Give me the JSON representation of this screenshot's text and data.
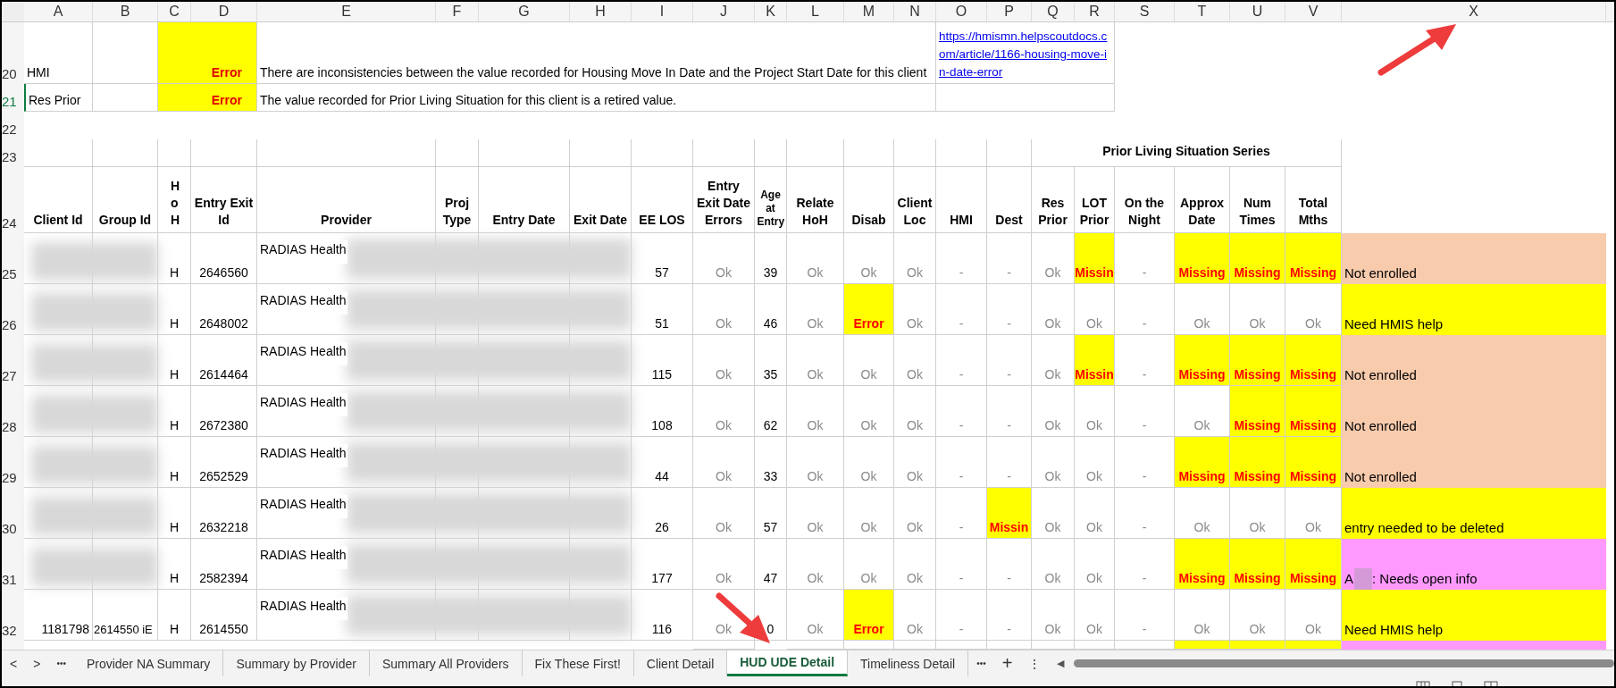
{
  "column_headers": [
    "A",
    "B",
    "C",
    "D",
    "E",
    "F",
    "G",
    "H",
    "I",
    "J",
    "K",
    "L",
    "M",
    "N",
    "O",
    "P",
    "Q",
    "R",
    "S",
    "T",
    "U",
    "V",
    "X"
  ],
  "notes": [
    {
      "row": "20",
      "active": false,
      "code": "HMI",
      "status": "Error",
      "text": "There are inconsistencies between the value recorded for Housing Move In Date and the Project Start Date for this client",
      "link": "https://hmismn.helpscoutdocs.com/article/1166-housing-move-in-date-error"
    },
    {
      "row": "21",
      "active": true,
      "code": "Res Prior",
      "status": "Error",
      "text": "The value recorded for Prior Living Situation for this client is a retired value."
    }
  ],
  "blank_row": "22",
  "group_row": {
    "row": "23",
    "title": "Prior Living Situation Series"
  },
  "header_row": {
    "row": "24",
    "headers": [
      "Client Id",
      "Group Id",
      "HoH",
      "Entry Exit Id",
      "Provider",
      "Proj Type",
      "Entry Date",
      "Exit Date",
      "EE LOS",
      "Entry Exit Date Errors",
      "Age at Entry",
      "Relate HoH",
      "Disab",
      "Client Loc",
      "HMI",
      "Dest",
      "Res Prior",
      "LOT Prior",
      "On the Night",
      "Approx Date",
      "Num Times",
      "Total Mths"
    ]
  },
  "rows": [
    {
      "row": "25",
      "redacted": true,
      "hoh": "H",
      "entry_exit_id": "2646560",
      "provider": "RADIAS Health",
      "ee_los": "57",
      "age": "39",
      "note": "Not enrolled",
      "color": "#f8cbad",
      "checks": [
        {
          "text": "Ok",
          "flagged": false
        },
        {
          "text": "Ok",
          "flagged": false
        },
        {
          "text": "Ok",
          "flagged": false
        },
        {
          "text": "Ok",
          "flagged": false
        },
        {
          "text": "-",
          "flagged": false
        },
        {
          "text": "-",
          "flagged": false
        },
        {
          "text": "Ok",
          "flagged": false
        },
        {
          "text": "Missin",
          "flagged": true
        },
        {
          "text": "-",
          "flagged": false
        },
        {
          "text": "Missing",
          "flagged": true
        },
        {
          "text": "Missing",
          "flagged": true
        },
        {
          "text": "Missing",
          "flagged": true
        }
      ]
    },
    {
      "row": "26",
      "redacted": true,
      "hoh": "H",
      "entry_exit_id": "2648002",
      "provider": "RADIAS Health",
      "ee_los": "51",
      "age": "46",
      "note": "Need HMIS help",
      "color": "#ffff00",
      "checks": [
        {
          "text": "Ok",
          "flagged": false
        },
        {
          "text": "Ok",
          "flagged": false
        },
        {
          "text": "Error",
          "flagged": true
        },
        {
          "text": "Ok",
          "flagged": false
        },
        {
          "text": "-",
          "flagged": false
        },
        {
          "text": "-",
          "flagged": false
        },
        {
          "text": "Ok",
          "flagged": false
        },
        {
          "text": "Ok",
          "flagged": false
        },
        {
          "text": "-",
          "flagged": false
        },
        {
          "text": "Ok",
          "flagged": false
        },
        {
          "text": "Ok",
          "flagged": false
        },
        {
          "text": "Ok",
          "flagged": false
        }
      ]
    },
    {
      "row": "27",
      "redacted": true,
      "hoh": "H",
      "entry_exit_id": "2614464",
      "provider": "RADIAS Health",
      "ee_los": "115",
      "age": "35",
      "note": "Not enrolled",
      "color": "#f8cbad",
      "checks": [
        {
          "text": "Ok",
          "flagged": false
        },
        {
          "text": "Ok",
          "flagged": false
        },
        {
          "text": "Ok",
          "flagged": false
        },
        {
          "text": "Ok",
          "flagged": false
        },
        {
          "text": "-",
          "flagged": false
        },
        {
          "text": "-",
          "flagged": false
        },
        {
          "text": "Ok",
          "flagged": false
        },
        {
          "text": "Missin",
          "flagged": true
        },
        {
          "text": "-",
          "flagged": false
        },
        {
          "text": "Missing",
          "flagged": true
        },
        {
          "text": "Missing",
          "flagged": true
        },
        {
          "text": "Missing",
          "flagged": true
        }
      ]
    },
    {
      "row": "28",
      "redacted": true,
      "hoh": "H",
      "entry_exit_id": "2672380",
      "provider": "RADIAS Health",
      "ee_los": "108",
      "age": "62",
      "note": "Not enrolled",
      "color": "#f8cbad",
      "checks": [
        {
          "text": "Ok",
          "flagged": false
        },
        {
          "text": "Ok",
          "flagged": false
        },
        {
          "text": "Ok",
          "flagged": false
        },
        {
          "text": "Ok",
          "flagged": false
        },
        {
          "text": "-",
          "flagged": false
        },
        {
          "text": "-",
          "flagged": false
        },
        {
          "text": "Ok",
          "flagged": false
        },
        {
          "text": "Ok",
          "flagged": false
        },
        {
          "text": "-",
          "flagged": false
        },
        {
          "text": "Ok",
          "flagged": false
        },
        {
          "text": "Missing",
          "flagged": true
        },
        {
          "text": "Missing",
          "flagged": true
        }
      ]
    },
    {
      "row": "29",
      "redacted": true,
      "hoh": "H",
      "entry_exit_id": "2652529",
      "provider": "RADIAS Health",
      "ee_los": "44",
      "age": "33",
      "note": "Not enrolled",
      "color": "#f8cbad",
      "checks": [
        {
          "text": "Ok",
          "flagged": false
        },
        {
          "text": "Ok",
          "flagged": false
        },
        {
          "text": "Ok",
          "flagged": false
        },
        {
          "text": "Ok",
          "flagged": false
        },
        {
          "text": "-",
          "flagged": false
        },
        {
          "text": "-",
          "flagged": false
        },
        {
          "text": "Ok",
          "flagged": false
        },
        {
          "text": "Ok",
          "flagged": false
        },
        {
          "text": "-",
          "flagged": false
        },
        {
          "text": "Missing",
          "flagged": true
        },
        {
          "text": "Missing",
          "flagged": true
        },
        {
          "text": "Missing",
          "flagged": true
        }
      ]
    },
    {
      "row": "30",
      "redacted": true,
      "hoh": "H",
      "entry_exit_id": "2632218",
      "provider": "RADIAS Health",
      "ee_los": "26",
      "age": "57",
      "note": "entry needed to be deleted",
      "color": "#ffff00",
      "checks": [
        {
          "text": "Ok",
          "flagged": false
        },
        {
          "text": "Ok",
          "flagged": false
        },
        {
          "text": "Ok",
          "flagged": false
        },
        {
          "text": "Ok",
          "flagged": false
        },
        {
          "text": "-",
          "flagged": false
        },
        {
          "text": "Missin",
          "flagged": true
        },
        {
          "text": "Ok",
          "flagged": false
        },
        {
          "text": "Ok",
          "flagged": false
        },
        {
          "text": "-",
          "flagged": false
        },
        {
          "text": "Ok",
          "flagged": false
        },
        {
          "text": "Ok",
          "flagged": false
        },
        {
          "text": "Ok",
          "flagged": false
        }
      ]
    },
    {
      "row": "31",
      "redacted": true,
      "hoh": "H",
      "entry_exit_id": "2582394",
      "provider": "RADIAS Health",
      "ee_los": "177",
      "age": "47",
      "note_prefix": "A",
      "note": ": Needs open info",
      "color": "#ff99ff",
      "checks": [
        {
          "text": "Ok",
          "flagged": false
        },
        {
          "text": "Ok",
          "flagged": false
        },
        {
          "text": "Ok",
          "flagged": false
        },
        {
          "text": "Ok",
          "flagged": false
        },
        {
          "text": "-",
          "flagged": false
        },
        {
          "text": "-",
          "flagged": false
        },
        {
          "text": "Ok",
          "flagged": false
        },
        {
          "text": "Ok",
          "flagged": false
        },
        {
          "text": "-",
          "flagged": false
        },
        {
          "text": "Missing",
          "flagged": true
        },
        {
          "text": "Missing",
          "flagged": true
        },
        {
          "text": "Missing",
          "flagged": true
        }
      ]
    },
    {
      "row": "32",
      "redacted": false,
      "client_id": "1181798",
      "group_id": "2614550 iE",
      "hoh": "H",
      "entry_exit_id": "2614550",
      "provider": "RADIAS Health",
      "ee_los": "116",
      "age": "0",
      "note": "Need HMIS help",
      "color": "#ffff00",
      "checks": [
        {
          "text": "Ok",
          "flagged": false
        },
        {
          "text": "Ok",
          "flagged": false
        },
        {
          "text": "Error",
          "flagged": true
        },
        {
          "text": "Ok",
          "flagged": false
        },
        {
          "text": "-",
          "flagged": false
        },
        {
          "text": "-",
          "flagged": false
        },
        {
          "text": "Ok",
          "flagged": false
        },
        {
          "text": "Ok",
          "flagged": false
        },
        {
          "text": "-",
          "flagged": false
        },
        {
          "text": "Ok",
          "flagged": false
        },
        {
          "text": "Ok",
          "flagged": false
        },
        {
          "text": "Ok",
          "flagged": false
        }
      ]
    }
  ],
  "partial_row": {
    "color": "#ff99ff",
    "flagged": [
      false,
      false,
      false,
      false,
      false,
      false,
      false,
      false,
      false,
      true,
      true,
      true
    ]
  },
  "sheet_tabs": [
    {
      "label": "Provider NA Summary",
      "selected": false
    },
    {
      "label": "Summary by Provider",
      "selected": false
    },
    {
      "label": "Summary All Providers",
      "selected": false
    },
    {
      "label": "Fix These First!",
      "selected": false
    },
    {
      "label": "Client Detail",
      "selected": false
    },
    {
      "label": "HUD UDE Detail",
      "selected": true
    },
    {
      "label": "Timeliness Detail",
      "selected": false
    }
  ],
  "tab_bar": {
    "prev": "<",
    "next": ">",
    "more_left": "•••",
    "more_right": "•••",
    "add": "+",
    "menu": "⋮",
    "scroll_left": "◀"
  }
}
